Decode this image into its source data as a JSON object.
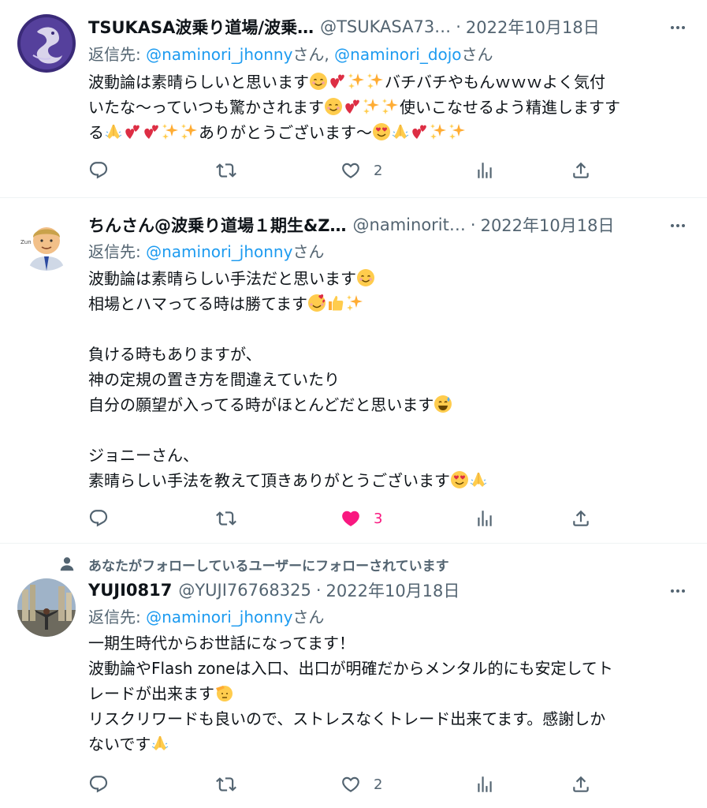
{
  "tweets": [
    {
      "author_name": "TSUKASA波乗り道場/波乗…",
      "handle": "@TSUKASA73…",
      "separator": "·",
      "date": "2022年10月18日",
      "reply_label": "返信先:",
      "reply_mentions": [
        "@naminori_jhonny",
        "@naminori_dojo"
      ],
      "reply_suffix": "さん",
      "reply_joiner": "さん, ",
      "lines": [
        "波動論は素晴らしいと思います",
        "バチバチやもんｗｗｗよく気付",
        "いたな〜っていつも驚かされます",
        "使いこなせるよう精進しますす",
        "る",
        "ありがとうございます〜"
      ],
      "reply_count": "",
      "retweet_count": "",
      "like_count": "2",
      "liked": false
    },
    {
      "author_name": "ちんさん@波乗り道場１期生&Z…",
      "handle": "@naminorit…",
      "separator": "·",
      "date": "2022年10月18日",
      "reply_label": "返信先:",
      "reply_mentions": [
        "@naminori_jhonny"
      ],
      "reply_suffix": "さん",
      "lines": [
        "波動論は素晴らしい手法だと思います",
        "相場とハマってる時は勝てます",
        "",
        "負ける時もありますが、",
        "神の定規の置き方を間違えていたり",
        "自分の願望が入ってる時がほとんどだと思います",
        "",
        "ジョニーさん、",
        "素晴らしい手法を教えて頂きありがとうございます"
      ],
      "like_count": "3",
      "liked": true
    },
    {
      "social_context": "あなたがフォローしているユーザーにフォローされています",
      "author_name": "YUJI0817",
      "handle": "@YUJI76768325",
      "separator": "·",
      "date": "2022年10月18日",
      "reply_label": "返信先:",
      "reply_mentions": [
        "@naminori_jhonny"
      ],
      "reply_suffix": "さん",
      "lines": [
        "一期生時代からお世話になってます！",
        "波動論やFlash zoneは入口、出口が明確だからメンタル的にも安定してト",
        "レードが出来ます",
        "リスクリワードも良いので、ストレスなくトレード出来てます。感謝しか",
        "ないです"
      ],
      "like_count": "2",
      "liked": false
    }
  ],
  "colors": {
    "text": "#0f1419",
    "secondary": "#536471",
    "link": "#1d9bf0",
    "like": "#f91880",
    "divider": "#eff3f4"
  },
  "icons": [
    "more-icon",
    "reply-icon",
    "retweet-icon",
    "like-icon",
    "views-icon",
    "share-icon",
    "person-icon"
  ]
}
